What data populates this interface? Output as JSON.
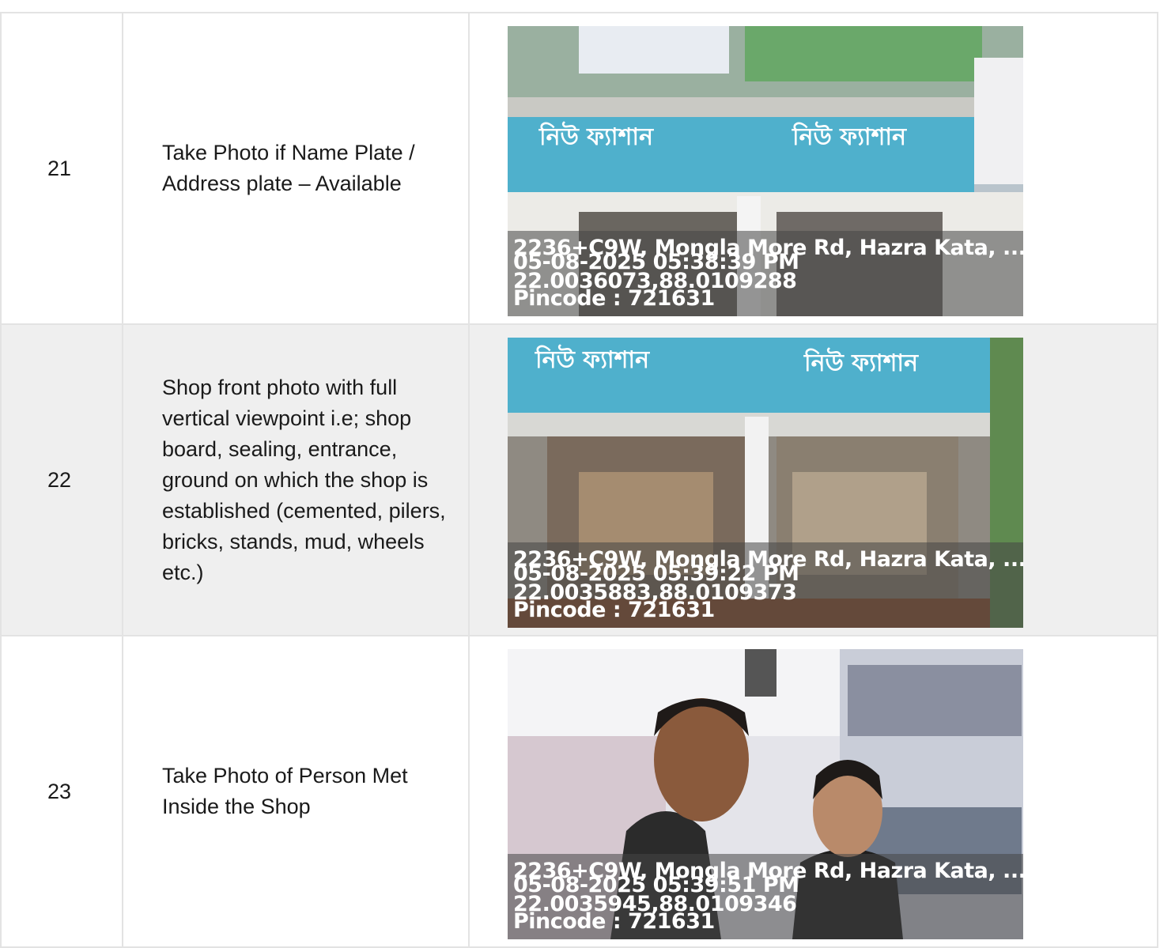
{
  "rows": [
    {
      "number": "21",
      "description": "Take Photo if Name Plate / Address plate – Available",
      "photo": {
        "address": "2236+C9W, Mongla More Rd, Hazra Kata, ...",
        "timestamp": "05-08-2025 05:38:39 PM",
        "coordinates": "22.0036073,88.0109288",
        "pincode": "Pincode : 721631",
        "sign_text": "নিউ ফ্যাশান"
      }
    },
    {
      "number": "22",
      "description": "Shop front photo with full vertical viewpoint i.e; shop board, sealing, entrance, ground on which the shop is established (cemented, pilers, bricks, stands, mud, wheels etc.)",
      "photo": {
        "address": "2236+C9W, Mongla More Rd, Hazra Kata, ...",
        "timestamp": "05-08-2025 05:39:22 PM",
        "coordinates": "22.0035883,88.0109373",
        "pincode": "Pincode : 721631",
        "sign_text": "নিউ ফ্যাশান"
      }
    },
    {
      "number": "23",
      "description": "Take Photo of Person Met Inside the Shop",
      "photo": {
        "address": "2236+C9W, Mongla More Rd, Hazra Kata, ...",
        "timestamp": "05-08-2025 05:39:51 PM",
        "coordinates": "22.0035945,88.0109346",
        "pincode": "Pincode : 721631"
      }
    }
  ]
}
